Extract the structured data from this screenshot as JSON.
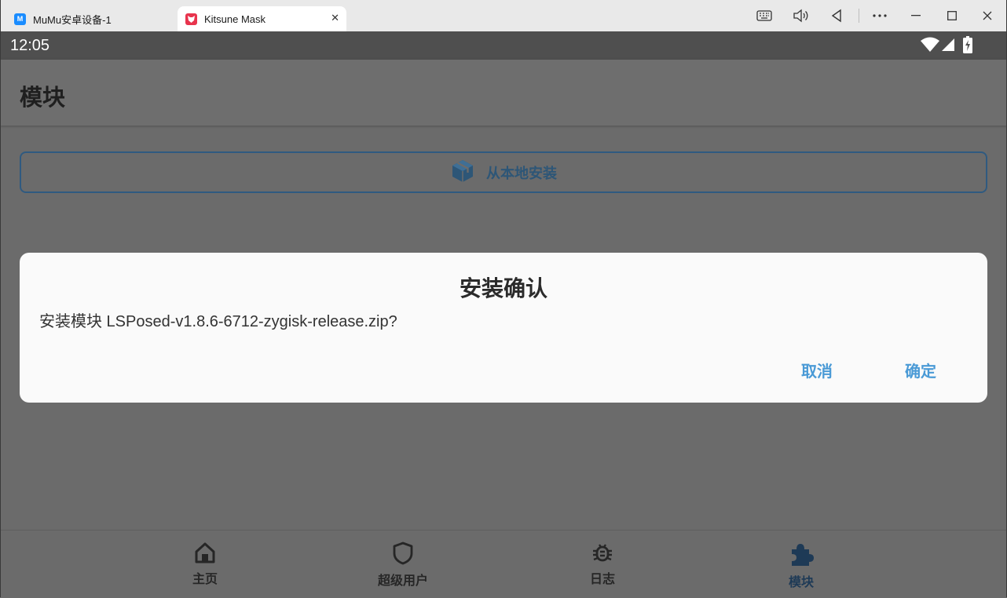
{
  "window": {
    "tabs": [
      {
        "label": "MuMu安卓设备-1",
        "icon": "mumu-logo-icon"
      },
      {
        "label": "Kitsune Mask",
        "icon": "kitsune-mask-logo-icon",
        "close": "✕"
      }
    ],
    "controls": [
      "keyboard-icon",
      "volume-icon",
      "back-triangle-icon",
      "more-icon",
      "minimize-icon",
      "maximize-icon",
      "close-icon"
    ]
  },
  "statusbar": {
    "time": "12:05"
  },
  "appbar": {
    "title": "模块"
  },
  "install_button": {
    "label": "从本地安装",
    "icon": "package-box-icon"
  },
  "dialog": {
    "title": "安装确认",
    "message": "安装模块 LSPosed-v1.8.6-6712-zygisk-release.zip?",
    "cancel_label": "取消",
    "confirm_label": "确定"
  },
  "bottom_nav": {
    "items": [
      {
        "label": "主页",
        "icon": "home-icon"
      },
      {
        "label": "超级用户",
        "icon": "shield-icon"
      },
      {
        "label": "日志",
        "icon": "bug-icon"
      },
      {
        "label": "模块",
        "icon": "puzzle-icon",
        "active": true
      }
    ]
  },
  "colors": {
    "accent": "#4a9ad6",
    "active_nav": "#1e3a56",
    "outline": "#2f5a80"
  }
}
